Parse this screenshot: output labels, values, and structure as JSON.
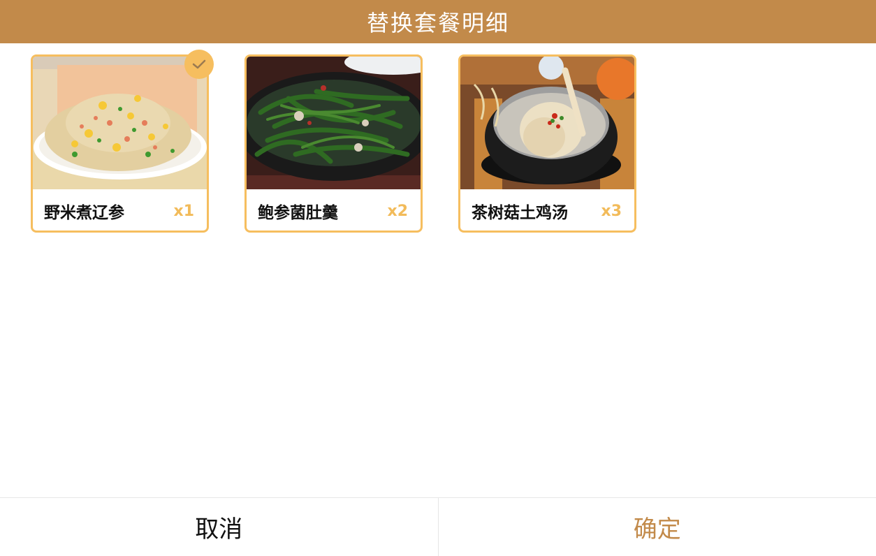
{
  "header": {
    "title": "替换套餐明细"
  },
  "dishes": [
    {
      "name": "野米煮辽参",
      "qty": "x1",
      "selected": true,
      "icon": "fried-rice-image"
    },
    {
      "name": "鲍参菌肚羹",
      "qty": "x2",
      "selected": false,
      "icon": "green-beans-image"
    },
    {
      "name": "茶树菇土鸡汤",
      "qty": "x3",
      "selected": false,
      "icon": "chicken-soup-image"
    }
  ],
  "footer": {
    "cancel_label": "取消",
    "confirm_label": "确定"
  },
  "colors": {
    "accent": "#c28a4a",
    "card_border": "#f6be5f",
    "qty": "#f2bb5a"
  }
}
